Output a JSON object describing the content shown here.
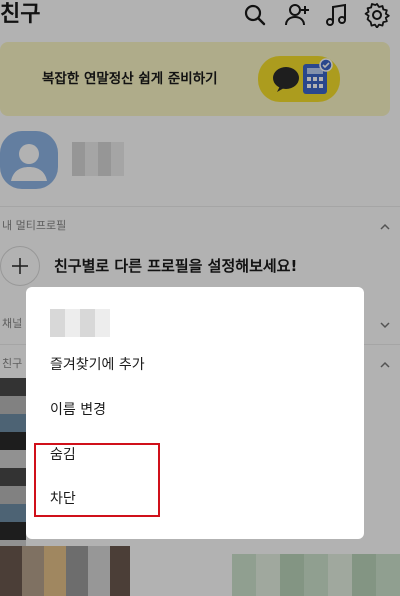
{
  "header": {
    "title": "친구",
    "icons": [
      "search-icon",
      "add-friend-icon",
      "music-icon",
      "settings-icon"
    ]
  },
  "banner": {
    "text": "복잡한 연말정산 쉽게 준비하기",
    "background": "#fbf7c6",
    "accent": "#f7e02c"
  },
  "sections": {
    "multi_profile": "내 멀티프로필",
    "channel": "채널",
    "friends": "친구"
  },
  "multi_profile": {
    "prompt": "친구별로 다른 프로필을 설정해보세요!"
  },
  "dialog": {
    "items": [
      "즐겨찾기에 추가",
      "이름 변경",
      "숨김",
      "차단"
    ],
    "highlight_color": "#d0101a"
  }
}
